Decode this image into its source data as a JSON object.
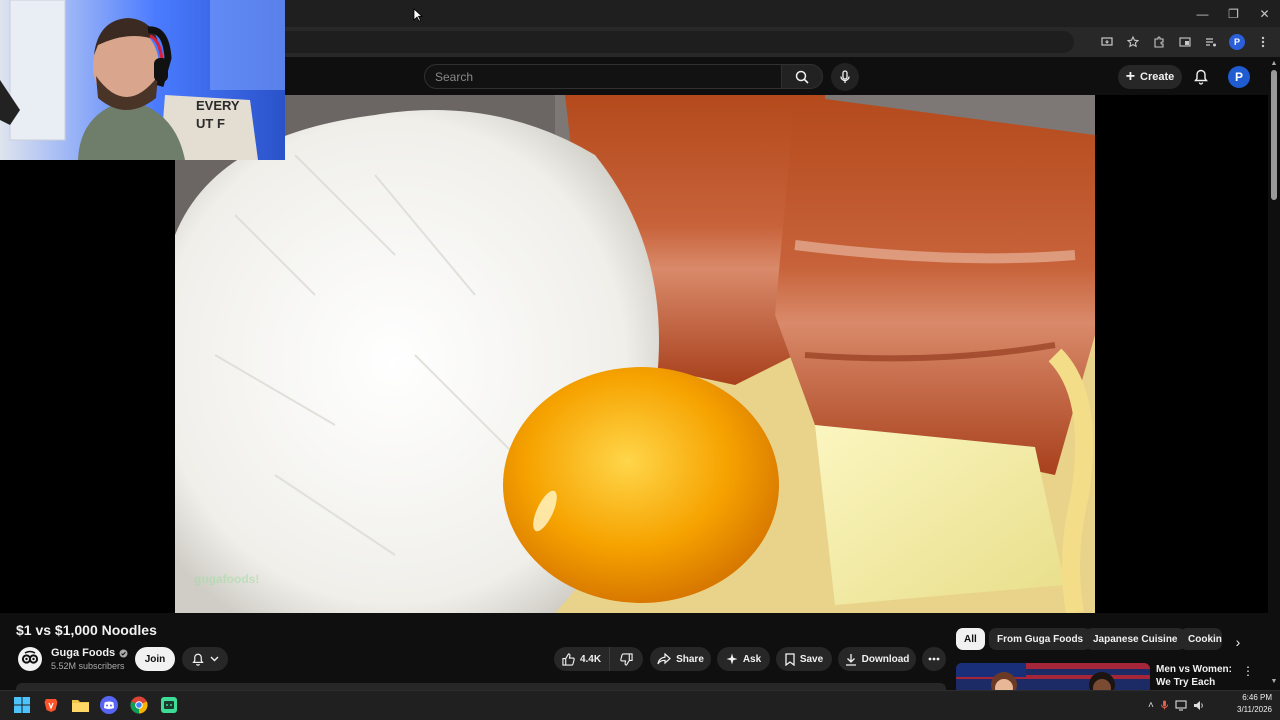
{
  "browser": {
    "window_controls": [
      "—",
      "❐",
      "✕"
    ]
  },
  "masthead": {
    "search_placeholder": "Search",
    "create_label": "Create",
    "avatar_letter": "P"
  },
  "video": {
    "watermark": "gugafoods!",
    "title": "$1 vs $1,000 Noodles"
  },
  "channel": {
    "name": "Guga Foods",
    "subscribers": "5.52M subscribers",
    "join_label": "Join"
  },
  "actions": {
    "like_count": "4.4K",
    "share_label": "Share",
    "ask_label": "Ask",
    "save_label": "Save",
    "download_label": "Download"
  },
  "chips": [
    "All",
    "From Guga Foods",
    "Japanese Cuisine",
    "Cooking"
  ],
  "recommendation": {
    "title": "Men vs Women: We Try Each Other's ..."
  },
  "taskbar": {
    "time": "6:46 PM",
    "date": "3/11/2026"
  },
  "colors": {
    "youtube_bg": "#0f0f0f",
    "pill_bg": "#272727",
    "avatar_blue": "#1f5bd1",
    "taskbar_bg": "#202020"
  }
}
